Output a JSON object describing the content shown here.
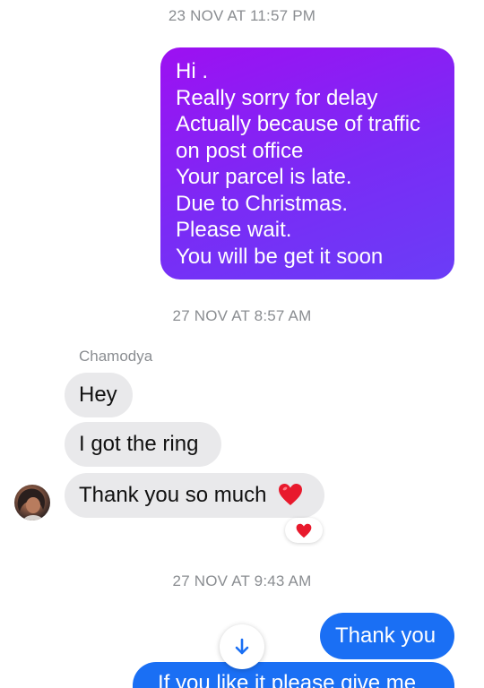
{
  "timestamps": {
    "first": "23 NOV AT 11:57 PM",
    "second": "27 NOV AT 8:57 AM",
    "third": "27 NOV AT 9:43 AM"
  },
  "outgoing_message": {
    "lines": [
      "Hi .",
      "Really sorry for delay",
      "Actually because of traffic",
      "on post office",
      "Your parcel is late.",
      "Due to Christmas.",
      "Please wait.",
      "You will be get it soon"
    ]
  },
  "incoming": {
    "sender": "Chamodya",
    "messages": [
      "Hey",
      "I got the ring",
      "Thank you so much"
    ],
    "reaction": "heart-icon"
  },
  "outgoing_recent": {
    "thank_you": "Thank you",
    "partial": "If you like it please give me"
  },
  "colors": {
    "gradient_start": "#9d10f2",
    "gradient_end": "#6a3df7",
    "outgoing_blue": "#1a6ff4",
    "incoming_bg": "#e9e9eb",
    "timestamp": "#8a8d91",
    "heart": "#e8192c"
  },
  "icons": {
    "scroll_down": "arrow-down-icon",
    "avatar": "avatar"
  }
}
